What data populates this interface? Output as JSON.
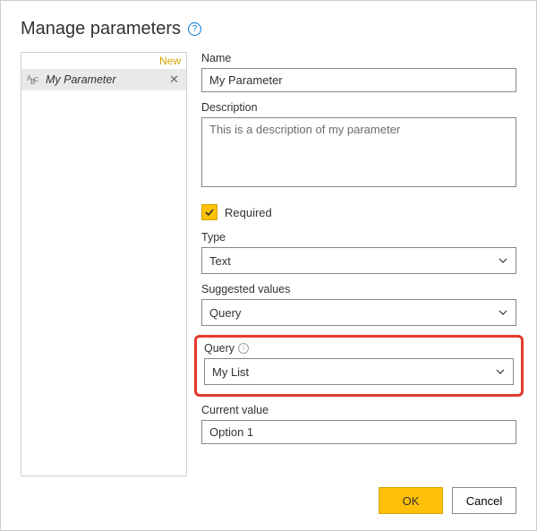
{
  "header": {
    "title": "Manage parameters"
  },
  "sidebar": {
    "new_label": "New",
    "items": [
      {
        "name": "My Parameter"
      }
    ]
  },
  "form": {
    "name_label": "Name",
    "name_value": "My Parameter",
    "description_label": "Description",
    "description_value": "This is a description of my parameter",
    "required_label": "Required",
    "required_checked": true,
    "type_label": "Type",
    "type_value": "Text",
    "suggested_label": "Suggested values",
    "suggested_value": "Query",
    "query_label": "Query",
    "query_value": "My List",
    "current_label": "Current value",
    "current_value": "Option 1"
  },
  "footer": {
    "ok_label": "OK",
    "cancel_label": "Cancel"
  },
  "colors": {
    "accent": "#ffc107",
    "highlight": "#e5392d",
    "link": "#0078d4"
  }
}
